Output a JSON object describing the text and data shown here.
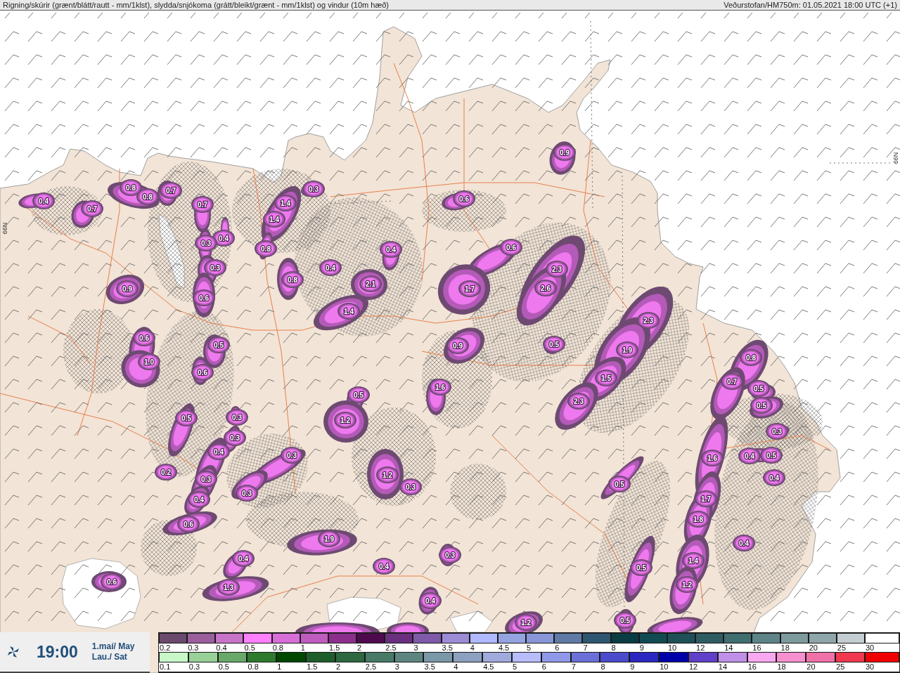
{
  "header": {
    "title": "Rigning/skúrir (grænt/blátt/rautt - mm/1klst), slydda/snjókoma (grátt/bleikt/grænt - mm/1klst) og vindur (10m hæð)",
    "source": "Veðurstofan/HM750m: 01.05.2021 18:00 UTC (+1)"
  },
  "map": {
    "latitude_labels": [
      "66N",
      "66N"
    ],
    "precipitation_values": [
      "0.4",
      "0.8",
      "0.8",
      "0.7",
      "0.7",
      "0.7",
      "0.4",
      "0.3",
      "0.3",
      "0.6",
      "1.4",
      "1.4",
      "0.3",
      "0.8",
      "0.9",
      "0.8",
      "0.4",
      "0.4",
      "2.1",
      "1.4",
      "0.6",
      "0.6",
      "1.7",
      "2.3",
      "2.6",
      "0.9",
      "0.5",
      "2.3",
      "1.9",
      "1.5",
      "2.3",
      "0.9",
      "0.6",
      "1.0",
      "0.5",
      "0.6",
      "1.6",
      "0.5",
      "0.5",
      "0.3",
      "1.2",
      "0.3",
      "0.4",
      "0.3",
      "0.2",
      "0.3",
      "0.3",
      "0.4",
      "0.6",
      "1.2",
      "0.3",
      "0.5",
      "1.9",
      "0.4",
      "0.4",
      "0.3",
      "1.3",
      "0.6",
      "0.4",
      "1.2",
      "0.5",
      "0.5",
      "0.8",
      "0.7",
      "0.5",
      "0.5",
      "0.3",
      "0.4",
      "0.5",
      "0.4",
      "1.6",
      "1.7",
      "1.8",
      "0.4",
      "1.4",
      "1.2"
    ]
  },
  "time_box": {
    "time": "19:00",
    "date": "1.maí/ May",
    "weekday": "Lau./ Sat"
  },
  "legend": {
    "rows": [
      {
        "swatches": [
          {
            "label": "0.2",
            "color": "#6b4a6e"
          },
          {
            "label": "0.3",
            "color": "#9b5f9e"
          },
          {
            "label": "0.4",
            "color": "#c874c8"
          },
          {
            "label": "0.5",
            "color": "#ff80ff"
          },
          {
            "label": "0.8",
            "color": "#d86ed8"
          },
          {
            "label": "1",
            "color": "#c05cc0"
          },
          {
            "label": "1.5",
            "color": "#8c2f8c"
          },
          {
            "label": "2",
            "color": "#4f0a4f"
          },
          {
            "label": "2.5",
            "color": "#6a2f7e"
          },
          {
            "label": "3",
            "color": "#7e5aa8"
          },
          {
            "label": "3.5",
            "color": "#9c8cd6"
          },
          {
            "label": "4",
            "color": "#b0b8ff"
          },
          {
            "label": "4.5",
            "color": "#93a4e0"
          },
          {
            "label": "5",
            "color": "#8896d8"
          },
          {
            "label": "6",
            "color": "#5f7aa6"
          },
          {
            "label": "7",
            "color": "#2f5670"
          },
          {
            "label": "8",
            "color": "#0a3c44"
          },
          {
            "label": "9",
            "color": "#124a52"
          },
          {
            "label": "10",
            "color": "#1f5058"
          },
          {
            "label": "12",
            "color": "#2f5c60"
          },
          {
            "label": "14",
            "color": "#416e70"
          },
          {
            "label": "16",
            "color": "#5e8488"
          },
          {
            "label": "18",
            "color": "#7d9a9c"
          },
          {
            "label": "20",
            "color": "#8fa6aa"
          },
          {
            "label": "25",
            "color": "#c4ced2"
          },
          {
            "label": "30",
            "color": "#ffffff"
          }
        ]
      },
      {
        "swatches": [
          {
            "label": "0.1",
            "color": "#c8f8c8"
          },
          {
            "label": "0.3",
            "color": "#98d098"
          },
          {
            "label": "0.5",
            "color": "#68a868"
          },
          {
            "label": "0.8",
            "color": "#2e7a2e"
          },
          {
            "label": "1",
            "color": "#004800"
          },
          {
            "label": "1.5",
            "color": "#1e5e2a"
          },
          {
            "label": "2",
            "color": "#2e6840"
          },
          {
            "label": "2.5",
            "color": "#487a68"
          },
          {
            "label": "3",
            "color": "#5e8680"
          },
          {
            "label": "3.5",
            "color": "#7a98a8"
          },
          {
            "label": "4",
            "color": "#8ea0c0"
          },
          {
            "label": "4.5",
            "color": "#a0aadc"
          },
          {
            "label": "5",
            "color": "#b8bcfa"
          },
          {
            "label": "6",
            "color": "#9098e8"
          },
          {
            "label": "7",
            "color": "#6a70d8"
          },
          {
            "label": "8",
            "color": "#4a4ccc"
          },
          {
            "label": "9",
            "color": "#2a28c0"
          },
          {
            "label": "10",
            "color": "#0000a8"
          },
          {
            "label": "12",
            "color": "#6040c8"
          },
          {
            "label": "14",
            "color": "#c090e8"
          },
          {
            "label": "16",
            "color": "#f8a8f0"
          },
          {
            "label": "18",
            "color": "#f890d0"
          },
          {
            "label": "20",
            "color": "#f070a8"
          },
          {
            "label": "25",
            "color": "#f03850"
          },
          {
            "label": "30",
            "color": "#f00000"
          }
        ]
      }
    ]
  }
}
